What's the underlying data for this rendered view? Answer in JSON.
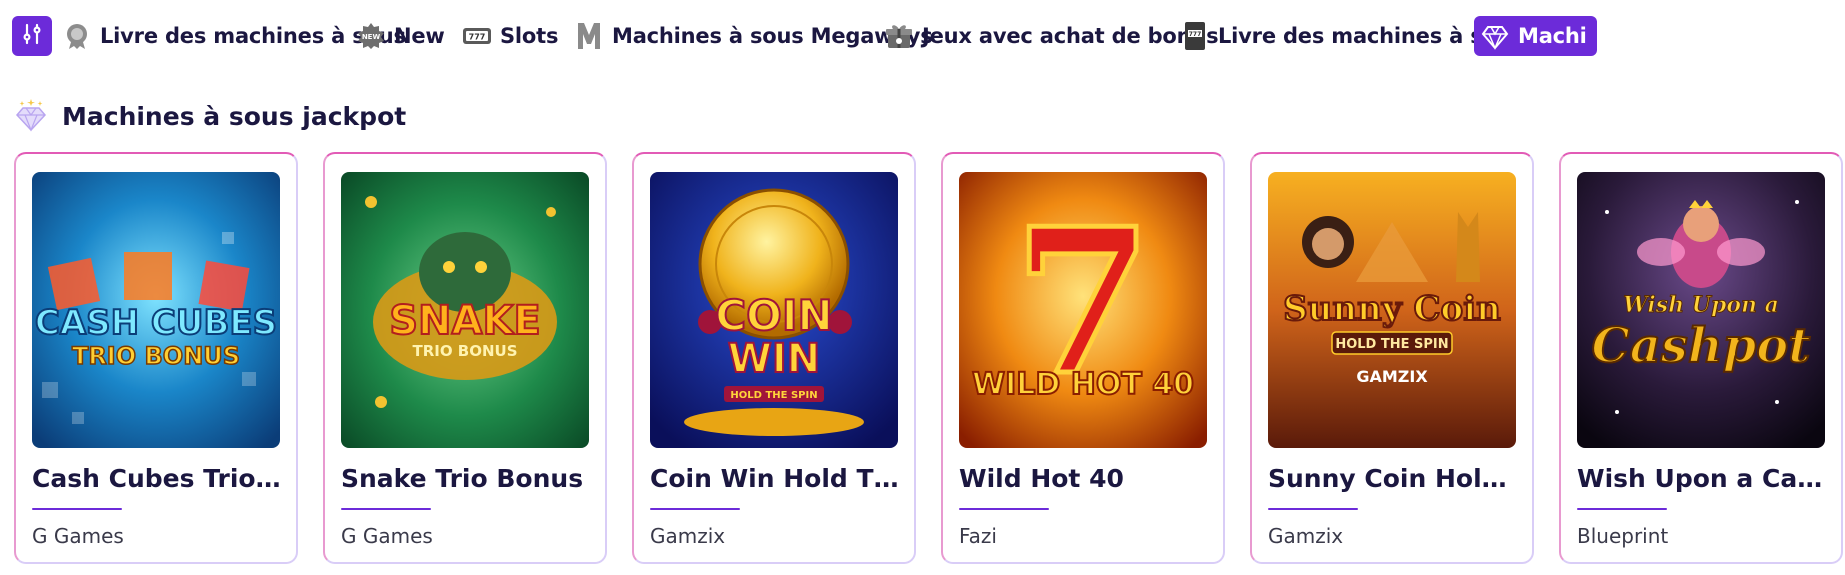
{
  "nav": {
    "filter_icon": "sliders-icon",
    "categories": [
      {
        "label": "Livre des machines à sous",
        "icon": "award-badge-icon"
      },
      {
        "label": "New",
        "icon": "new-badge-icon"
      },
      {
        "label": "Slots",
        "icon": "777-slot-icon"
      },
      {
        "label": "Machines à sous Megaways",
        "icon": "megaways-m-icon"
      },
      {
        "label": "Jeux avec achat de bonus",
        "icon": "gift-box-icon"
      },
      {
        "label": "Livre des machines à sous",
        "icon": "book-slot-icon"
      },
      {
        "label": "Machi",
        "icon": "diamond-icon",
        "active": true
      }
    ],
    "accent_color": "#6c2bd9"
  },
  "section": {
    "title": "Machines à sous jackpot",
    "icon": "diamond-icon"
  },
  "games": [
    {
      "name": "Cash Cubes Trio ...",
      "provider": "G Games",
      "art_text": [
        "CASH CUBES",
        "TRIO BONUS"
      ]
    },
    {
      "name": "Snake Trio Bonus",
      "provider": "G Games",
      "art_text": [
        "SNAKE",
        "TRIO BONUS"
      ]
    },
    {
      "name": "Coin Win Hold Th...",
      "provider": "Gamzix",
      "art_text": [
        "COIN",
        "WIN",
        "HOLD THE SPIN"
      ]
    },
    {
      "name": "Wild Hot 40",
      "provider": "Fazi",
      "art_text": [
        "7",
        "WILD HOT 40"
      ]
    },
    {
      "name": "Sunny Coin Hold ...",
      "provider": "Gamzix",
      "art_text": [
        "Sunny Coin",
        "HOLD THE SPIN",
        "GAMZIX"
      ]
    },
    {
      "name": "Wish Upon a Cas...",
      "provider": "Blueprint",
      "art_text": [
        "Wish Upon a",
        "Cashpot"
      ]
    }
  ]
}
